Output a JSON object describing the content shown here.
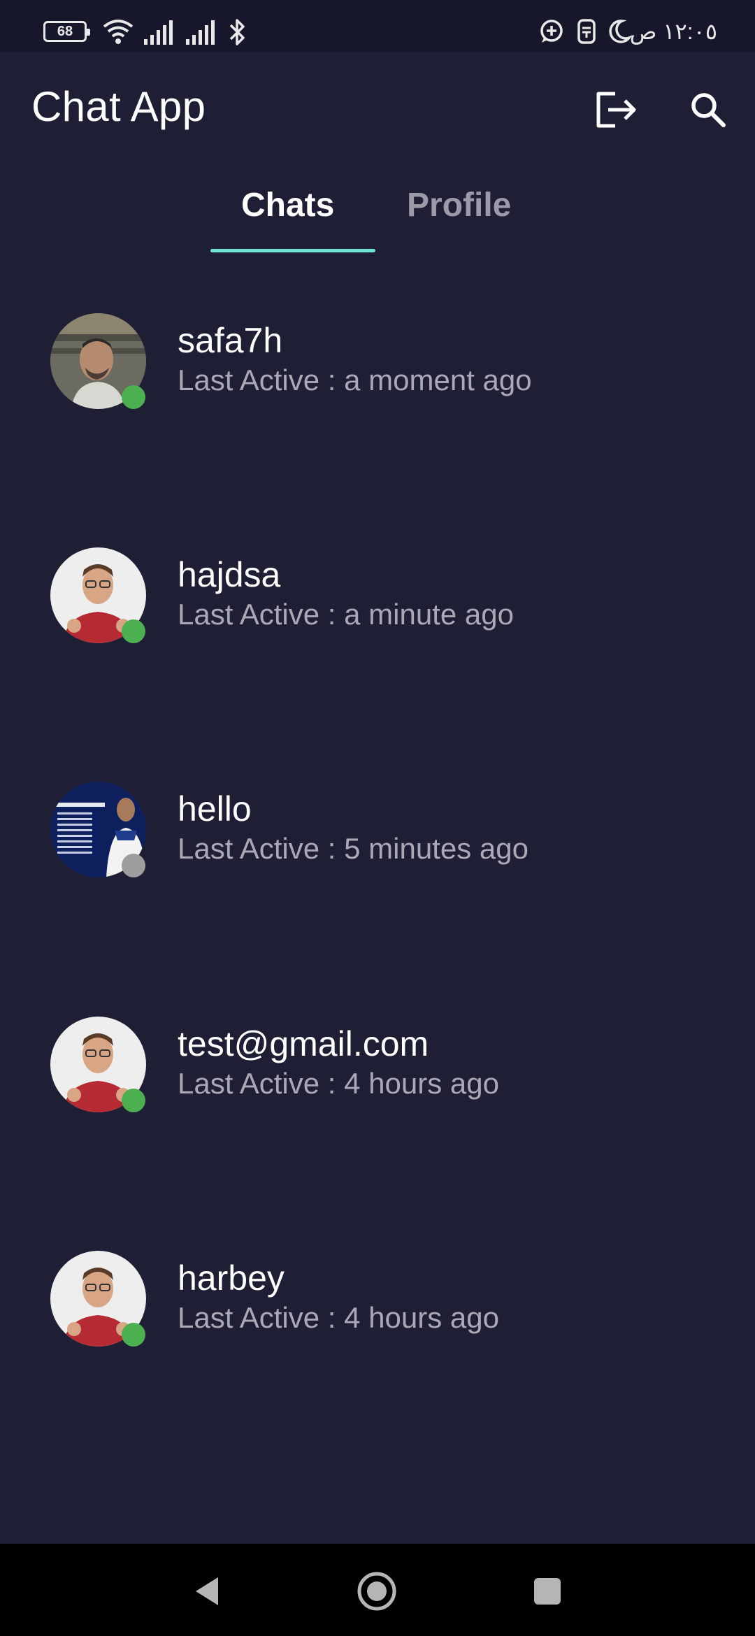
{
  "status_bar": {
    "battery_level": "68",
    "time": "١٢:٠٥ ص"
  },
  "header": {
    "title": "Chat App",
    "logout_icon": "logout-icon",
    "search_icon": "search-icon"
  },
  "tabs": [
    {
      "label": "Chats",
      "active": true
    },
    {
      "label": "Profile",
      "active": false
    }
  ],
  "chats": [
    {
      "name": "safa7h",
      "status": "Last Active : a moment ago",
      "online": true
    },
    {
      "name": "hajdsa",
      "status": "Last Active : a minute ago",
      "online": true
    },
    {
      "name": "hello",
      "status": "Last Active : 5 minutes ago",
      "online": false
    },
    {
      "name": "test@gmail.com",
      "status": "Last Active : 4 hours ago",
      "online": true
    },
    {
      "name": "harbey",
      "status": "Last Active : 4 hours ago",
      "online": true
    }
  ],
  "colors": {
    "background": "#1e1e34",
    "accent": "#6fe3d4",
    "online": "#4caf50",
    "offline": "#9e9e9e"
  }
}
